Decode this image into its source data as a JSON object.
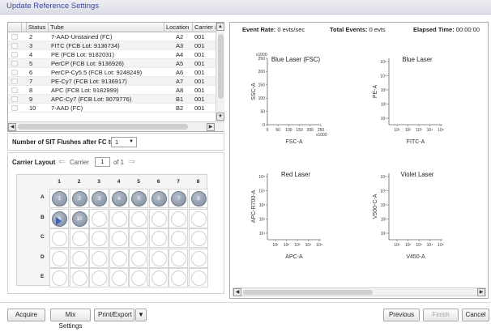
{
  "window": {
    "title": "Update Reference Settings"
  },
  "tube_table": {
    "columns": [
      "Status",
      "Tube",
      "Location",
      "Carrier #"
    ],
    "rows": [
      {
        "num": "2",
        "tube": "7-AAD-Unstained (FC)",
        "location": "A2",
        "carrier": "001"
      },
      {
        "num": "3",
        "tube": "FITC (FCB Lot: 9136734)",
        "location": "A3",
        "carrier": "001"
      },
      {
        "num": "4",
        "tube": "PE (FCB Lot: 9182031)",
        "location": "A4",
        "carrier": "001"
      },
      {
        "num": "5",
        "tube": "PerCP (FCB Lot: 9136926)",
        "location": "A5",
        "carrier": "001"
      },
      {
        "num": "6",
        "tube": "PerCP-Cy5.5 (FCB Lot: 9248249)",
        "location": "A6",
        "carrier": "001"
      },
      {
        "num": "7",
        "tube": "PE-Cy7 (FCB Lot: 9136917)",
        "location": "A7",
        "carrier": "001"
      },
      {
        "num": "8",
        "tube": "APC (FCB Lot: 9182999)",
        "location": "A8",
        "carrier": "001"
      },
      {
        "num": "9",
        "tube": "APC-Cy7 (FCB Lot: 9079776)",
        "location": "B1",
        "carrier": "001"
      },
      {
        "num": "10",
        "tube": "7-AAD (FC)",
        "location": "B2",
        "carrier": "001"
      }
    ]
  },
  "flushes": {
    "label": "Number of SIT Flushes after FC tube",
    "value": "1"
  },
  "carrier_layout": {
    "label": "Carrier Layout",
    "carrier_label": "Carrier",
    "carrier_value": "1",
    "of_text": "of 1",
    "columns": [
      "1",
      "2",
      "3",
      "4",
      "5",
      "6",
      "7",
      "8"
    ],
    "rows": [
      "A",
      "B",
      "C",
      "D",
      "E"
    ],
    "filled_wells": [
      {
        "row": "A",
        "col": 1,
        "label": "1"
      },
      {
        "row": "A",
        "col": 2,
        "label": "2"
      },
      {
        "row": "A",
        "col": 3,
        "label": "3"
      },
      {
        "row": "A",
        "col": 4,
        "label": "4"
      },
      {
        "row": "A",
        "col": 5,
        "label": "5"
      },
      {
        "row": "A",
        "col": 6,
        "label": "6"
      },
      {
        "row": "A",
        "col": 7,
        "label": "7"
      },
      {
        "row": "A",
        "col": 8,
        "label": "8"
      },
      {
        "row": "B",
        "col": 1,
        "label": "9"
      },
      {
        "row": "B",
        "col": 2,
        "label": "10"
      }
    ]
  },
  "stats": {
    "event_rate_label": "Event Rate:",
    "event_rate_value": "0 evts/sec",
    "total_events_label": "Total Events:",
    "total_events_value": "0 evts",
    "elapsed_label": "Elapsed Time:",
    "elapsed_value": "00:00:00"
  },
  "plots": [
    {
      "title": "Blue Laser (FSC)",
      "xlabel": "FSC-A",
      "ylabel": "SSC-A",
      "scale": "linear",
      "x_ticks": [
        "0",
        "50",
        "100",
        "150",
        "200",
        "250"
      ],
      "y_ticks": [
        "0",
        "50",
        "100",
        "150",
        "200",
        "250"
      ],
      "multiplier": "x1000"
    },
    {
      "title": "Blue Laser",
      "xlabel": "FITC-A",
      "ylabel": "PE-A",
      "scale": "log",
      "x_ticks": [
        "10¹",
        "10²",
        "10³",
        "10⁴",
        "10⁵"
      ],
      "y_ticks": [
        "10¹",
        "10²",
        "10³",
        "10⁴",
        "10⁵"
      ]
    },
    {
      "title": "Red Laser",
      "xlabel": "APC-A",
      "ylabel": "APC-R700-A",
      "scale": "log",
      "x_ticks": [
        "10¹",
        "10²",
        "10³",
        "10⁴",
        "10⁵"
      ],
      "y_ticks": [
        "10¹",
        "10²",
        "10³",
        "10⁴",
        "10⁵"
      ]
    },
    {
      "title": "Violet Laser",
      "xlabel": "V450-A",
      "ylabel": "V500-C-A",
      "scale": "log",
      "x_ticks": [
        "10¹",
        "10²",
        "10³",
        "10⁴",
        "10⁵"
      ],
      "y_ticks": [
        "10¹",
        "10²",
        "10³",
        "10⁴",
        "10⁵"
      ]
    }
  ],
  "buttons": {
    "acquire": "Acquire",
    "mix_settings": "Mix Settings",
    "print_export": "Print/Export",
    "previous": "Previous",
    "finish": "Finish",
    "cancel": "Cancel"
  }
}
